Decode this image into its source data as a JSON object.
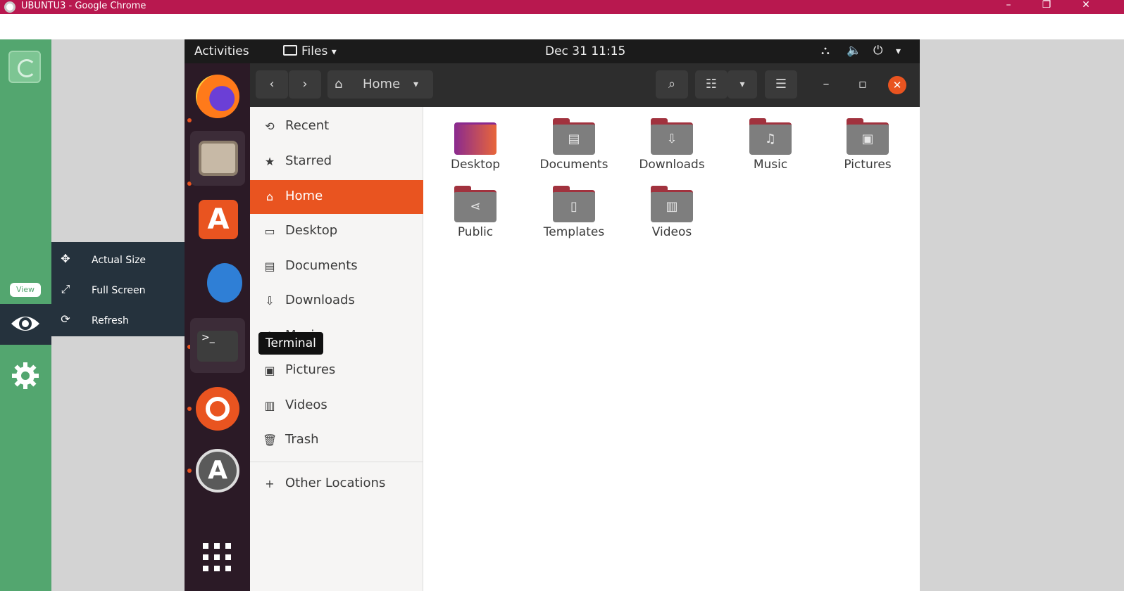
{
  "chrome": {
    "title": "UBUNTU3 - Google Chrome",
    "min_glyph": "–",
    "restore_glyph": "❐",
    "close_glyph": "✕"
  },
  "remote_viewer": {
    "view_label": "View",
    "menu": [
      {
        "label": "Actual Size",
        "icon": "actual-size-icon",
        "glyph": "✥"
      },
      {
        "label": "Full Screen",
        "icon": "fullscreen-icon",
        "glyph": "⤢"
      },
      {
        "label": "Refresh",
        "icon": "refresh-icon",
        "glyph": "⟳"
      }
    ]
  },
  "topbar": {
    "activities": "Activities",
    "app_menu": "Files",
    "app_menu_caret": "▾",
    "clock": "Dec 31  11:15",
    "network_glyph": "⛬",
    "volume_glyph": "🔈",
    "power_glyph": "⏻",
    "caret_glyph": "▾"
  },
  "headerbar": {
    "back_glyph": "‹",
    "forward_glyph": "›",
    "location": "Home",
    "location_caret": "▾",
    "search_glyph": "⌕",
    "view_glyph": "☷",
    "view_caret": "▾",
    "menu_glyph": "☰",
    "minimize_glyph": "–",
    "maximize_glyph": "▫",
    "close_glyph": "✕"
  },
  "sidebar": {
    "items": [
      {
        "label": "Recent",
        "glyph": "⟲",
        "icon": "recent-icon",
        "selected": false
      },
      {
        "label": "Starred",
        "glyph": "★",
        "icon": "star-icon",
        "selected": false
      },
      {
        "label": "Home",
        "glyph": "⌂",
        "icon": "home-icon",
        "selected": true
      },
      {
        "label": "Desktop",
        "glyph": "▭",
        "icon": "desktop-icon",
        "selected": false
      },
      {
        "label": "Documents",
        "glyph": "▤",
        "icon": "documents-icon",
        "selected": false
      },
      {
        "label": "Downloads",
        "glyph": "⇩",
        "icon": "downloads-icon",
        "selected": false
      },
      {
        "label": "Music",
        "glyph": "♫",
        "icon": "music-icon",
        "selected": false
      },
      {
        "label": "Pictures",
        "glyph": "▣",
        "icon": "pictures-icon",
        "selected": false
      },
      {
        "label": "Videos",
        "glyph": "▥",
        "icon": "videos-icon",
        "selected": false
      },
      {
        "label": "Trash",
        "glyph": "🗑",
        "icon": "trash-icon",
        "selected": false
      }
    ],
    "other_locations": {
      "label": "Other Locations",
      "glyph": "+"
    }
  },
  "tooltip": "Terminal",
  "folders": [
    {
      "label": "Desktop",
      "glyph": "",
      "icon": "desktop-folder-icon"
    },
    {
      "label": "Documents",
      "glyph": "▤",
      "icon": "documents-folder-icon"
    },
    {
      "label": "Downloads",
      "glyph": "⇩",
      "icon": "downloads-folder-icon"
    },
    {
      "label": "Music",
      "glyph": "♫",
      "icon": "music-folder-icon"
    },
    {
      "label": "Pictures",
      "glyph": "▣",
      "icon": "pictures-folder-icon"
    },
    {
      "label": "Public",
      "glyph": "⋖",
      "icon": "public-folder-icon"
    },
    {
      "label": "Templates",
      "glyph": "▯",
      "icon": "templates-folder-icon"
    },
    {
      "label": "Videos",
      "glyph": "▥",
      "icon": "videos-folder-icon"
    }
  ],
  "colors": {
    "ubuntu_orange": "#e95420",
    "dock_bg": "#2b1a26",
    "remote_viewer_green": "#53a66f",
    "chrome_titlebar": "#b8184f",
    "folder_accent": "#a1323e"
  }
}
